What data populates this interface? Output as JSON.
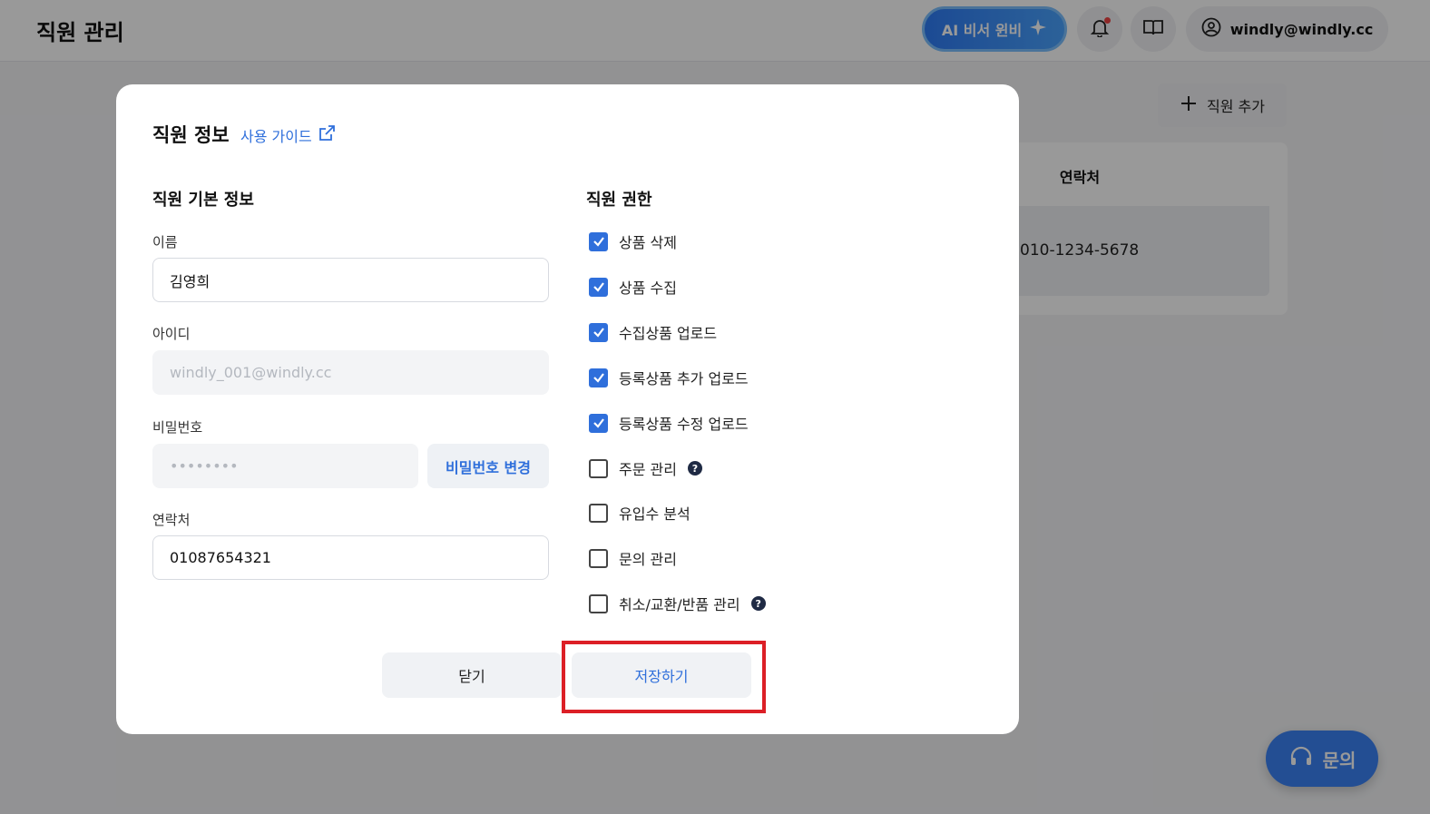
{
  "header": {
    "title": "직원 관리",
    "ai_button_label": "AI 비서 윈비",
    "account_email": "windly@windly.cc"
  },
  "background": {
    "add_staff_label": "직원 추가",
    "table_header_contact": "연락처",
    "row_contact": "010-1234-5678",
    "inquiry_label": "문의"
  },
  "modal": {
    "title": "직원 정보",
    "guide_link": "사용 가이드",
    "basic_section_title": "직원 기본 정보",
    "name_label": "이름",
    "name_value": "김영희",
    "id_label": "아이디",
    "id_value": "windly_001@windly.cc",
    "password_label": "비밀번호",
    "password_value": "••••••••",
    "password_change_label": "비밀번호 변경",
    "contact_label": "연락처",
    "contact_value": "01087654321",
    "permission_section_title": "직원 권한",
    "permissions": [
      {
        "label": "상품 삭제",
        "checked": true,
        "help": false
      },
      {
        "label": "상품 수집",
        "checked": true,
        "help": false
      },
      {
        "label": "수집상품 업로드",
        "checked": true,
        "help": false
      },
      {
        "label": "등록상품 추가 업로드",
        "checked": true,
        "help": false
      },
      {
        "label": "등록상품 수정 업로드",
        "checked": true,
        "help": false
      },
      {
        "label": "주문 관리",
        "checked": false,
        "help": true
      },
      {
        "label": "유입수 분석",
        "checked": false,
        "help": false
      },
      {
        "label": "문의 관리",
        "checked": false,
        "help": false
      },
      {
        "label": "취소/교환/반품 관리",
        "checked": false,
        "help": true
      }
    ],
    "close_label": "닫기",
    "save_label": "저장하기"
  },
  "colors": {
    "accent": "#2f6fdb",
    "highlight": "#dc1f26",
    "checkbox_checked": "#2f6fdb"
  }
}
